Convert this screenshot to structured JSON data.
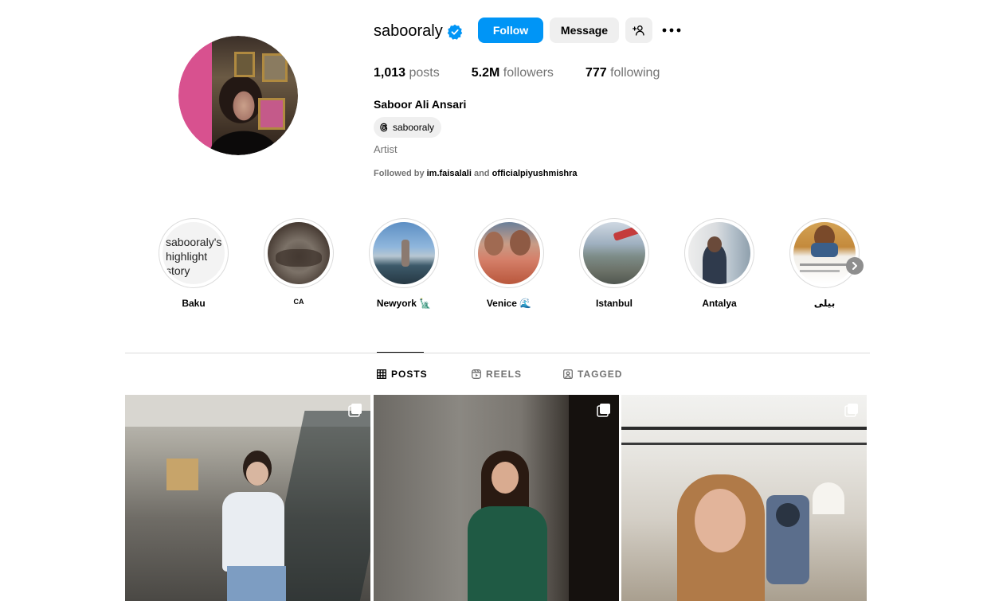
{
  "profile": {
    "username": "sabooraly",
    "verified": true,
    "buttons": {
      "follow": "Follow",
      "message": "Message"
    },
    "stats": {
      "posts_value": "1,013",
      "posts_label": "posts",
      "followers_value": "5.2M",
      "followers_label": "followers",
      "following_value": "777",
      "following_label": "following"
    },
    "full_name": "Saboor Ali Ansari",
    "threads_handle": "sabooraly",
    "category": "Artist",
    "followed_by": {
      "prefix": "Followed by",
      "account_1": "im.faisalali",
      "joiner": "and",
      "account_2": "officialpiyushmishra"
    }
  },
  "highlights": [
    {
      "label": "Baku",
      "broken_alt": "sabooraly's highlight story"
    },
    {
      "label": "CA"
    },
    {
      "label": "Newyork 🗽"
    },
    {
      "label": "Venice 🌊"
    },
    {
      "label": "Istanbul"
    },
    {
      "label": "Antalya"
    },
    {
      "label": "بیلی"
    }
  ],
  "tabs": [
    {
      "label": "POSTS",
      "active": true,
      "icon": "grid-icon"
    },
    {
      "label": "REELS",
      "active": false,
      "icon": "reels-icon"
    },
    {
      "label": "TAGGED",
      "active": false,
      "icon": "tagged-icon"
    }
  ],
  "colors": {
    "primary_button": "#0095f6",
    "secondary_button": "#efefef",
    "muted_text": "#737373",
    "verified_badge": "#0095f6"
  }
}
